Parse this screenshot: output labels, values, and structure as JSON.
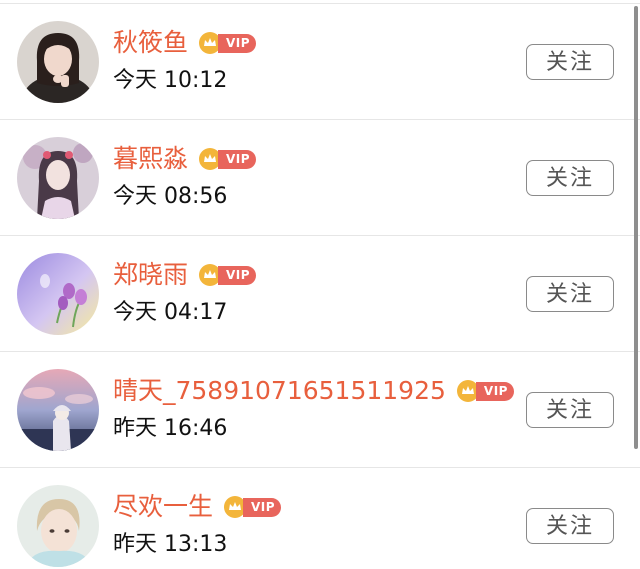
{
  "users": [
    {
      "name": "秋筱鱼",
      "time": "今天 10:12",
      "badge": "VIP",
      "follow_label": "关注",
      "avatar_icon": "avatar-portrait-dark-hair"
    },
    {
      "name": "暮熙淼",
      "time": "今天 08:56",
      "badge": "VIP",
      "follow_label": "关注",
      "avatar_icon": "avatar-anime-girl"
    },
    {
      "name": "郑晓雨",
      "time": "今天 04:17",
      "badge": "VIP",
      "follow_label": "关注",
      "avatar_icon": "avatar-tulips-purple"
    },
    {
      "name": "晴天_7589107165151192​5",
      "time": "昨天 16:46",
      "badge": "VIP",
      "follow_label": "关注",
      "avatar_icon": "avatar-sunset-figure"
    },
    {
      "name": "尽欢一生",
      "time": "昨天 13:13",
      "badge": "VIP",
      "follow_label": "关注",
      "avatar_icon": "avatar-young-man"
    }
  ],
  "colors": {
    "name": "#e85f3d",
    "vip_badge": "#e8655c",
    "crown": "#f3b53a",
    "divider": "#e6e6e6",
    "button_border": "#8a8a8a"
  }
}
